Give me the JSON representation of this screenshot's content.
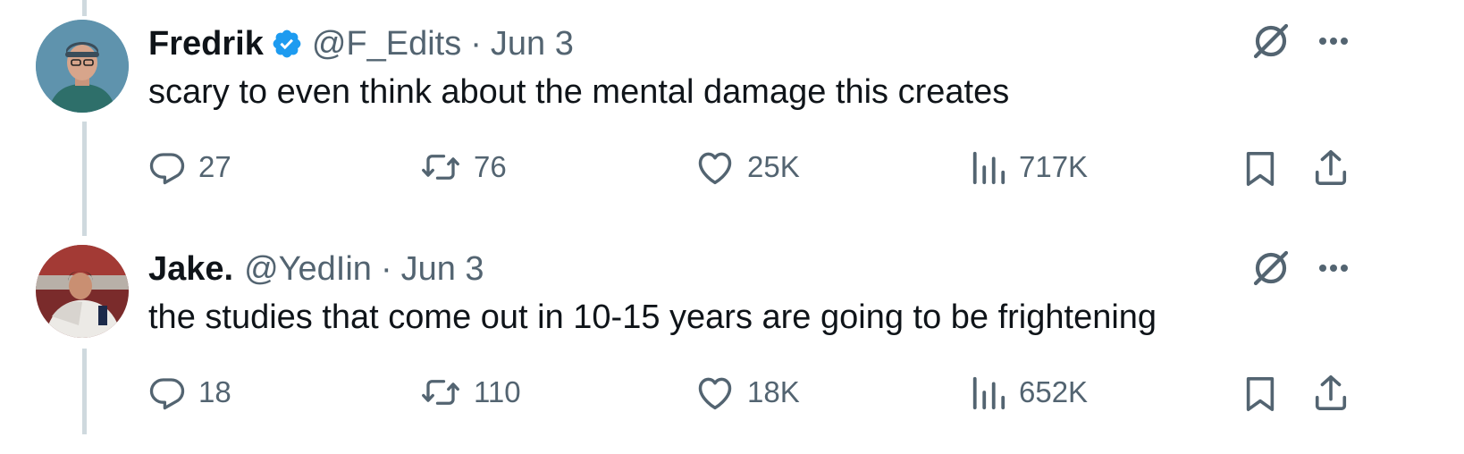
{
  "tweets": [
    {
      "name": "Fredrik",
      "verified": true,
      "handle": "@F_Edits",
      "separator": "·",
      "date": "Jun 3",
      "text": "scary to even think about the mental damage this creates",
      "replies": "27",
      "reposts": "76",
      "likes": "25K",
      "views": "717K"
    },
    {
      "name": "Jake.",
      "verified": false,
      "handle": "@YedIin",
      "separator": "·",
      "date": "Jun 3",
      "text": "the studies that come out in 10-15 years are going to be frightening",
      "replies": "18",
      "reposts": "110",
      "likes": "18K",
      "views": "652K"
    }
  ],
  "icons": {
    "reply": "reply-icon",
    "repost": "repost-icon",
    "like": "heart-icon",
    "views": "views-icon",
    "bookmark": "bookmark-icon",
    "share": "share-icon",
    "grok": "grok-icon",
    "more": "more-icon",
    "verified": "verified-badge-icon"
  },
  "colors": {
    "text": "#0f1419",
    "muted": "#536471",
    "verified": "#1d9bf0",
    "thread_line": "#cfd9de"
  }
}
